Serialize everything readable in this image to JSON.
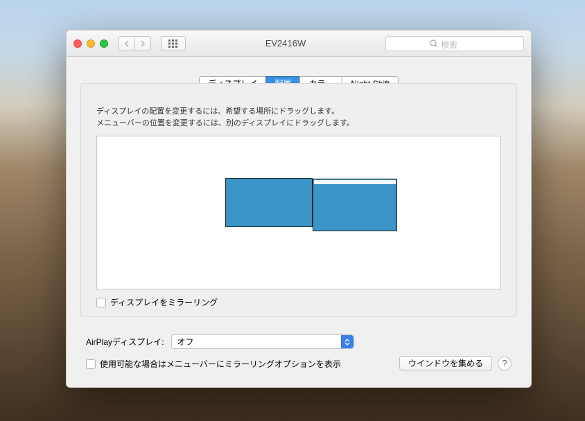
{
  "window": {
    "title": "EV2416W",
    "search_placeholder": "検索"
  },
  "tabs": {
    "display": "ディスプレイ",
    "arrangement": "配置",
    "color": "カラー",
    "night_shift": "Night Shift",
    "active": "arrangement"
  },
  "panel": {
    "instruction_line1": "ディスプレイの配置を変更するには、希望する場所にドラッグします。",
    "instruction_line2": "メニューバーの位置を変更するには、別のディスプレイにドラッグします。",
    "mirror_label": "ディスプレイをミラーリング",
    "mirror_checked": false
  },
  "airplay": {
    "label": "AirPlayディスプレイ:",
    "value": "オフ"
  },
  "footer": {
    "show_mirroring_label": "使用可能な場合はメニューバーにミラーリングオプションを表示",
    "show_mirroring_checked": false,
    "gather_windows": "ウインドウを集める"
  },
  "colors": {
    "display_fill": "#3a94c6",
    "tab_active": "#3a8fe3"
  }
}
